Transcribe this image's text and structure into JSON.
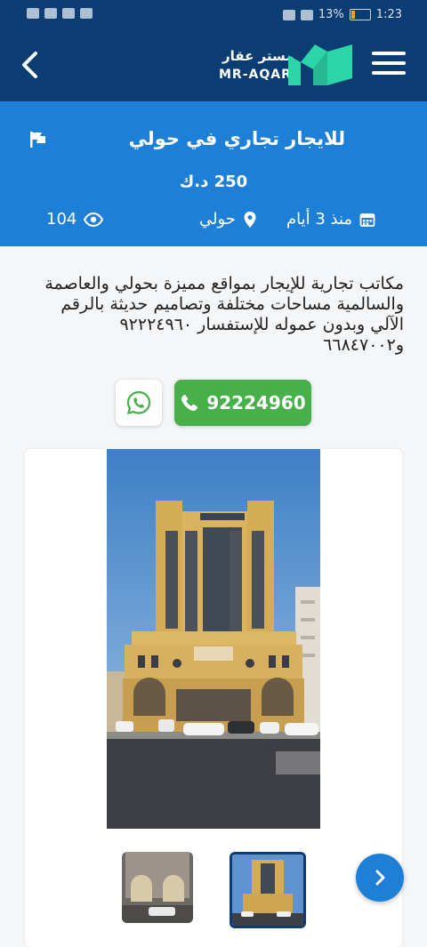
{
  "status_bar": {
    "battery": "13%",
    "time": "1:23"
  },
  "logo": {
    "arabic": "مستر عقار",
    "english": "MR-AQAR"
  },
  "listing": {
    "title": "للايجار تجاري في حولي",
    "price": "250 د.ك",
    "posted": "منذ 3 أيام",
    "location": "حولي",
    "views": "104",
    "description": "مكاتب تجارية للإيجار بمواقع مميزة بحولي والعاصمة والسالمية مساحات مختلفة وتصاميم حديثة بالرقم الآلي وبدون عموله للإستفسار ٩٢٢٢٤٩٦٠ و٦٦٨٤٧٠٠٢"
  },
  "contact": {
    "phone": "92224960"
  },
  "colors": {
    "navy": "#0b3d73",
    "blue": "#1e7fd6",
    "green": "#47b04b",
    "teal": "#2dd4a8"
  },
  "icons": [
    "back-icon",
    "menu-icon",
    "flag-icon",
    "calendar-icon",
    "location-icon",
    "eye-icon",
    "whatsapp-icon",
    "phone-icon",
    "chevron-right-icon"
  ]
}
